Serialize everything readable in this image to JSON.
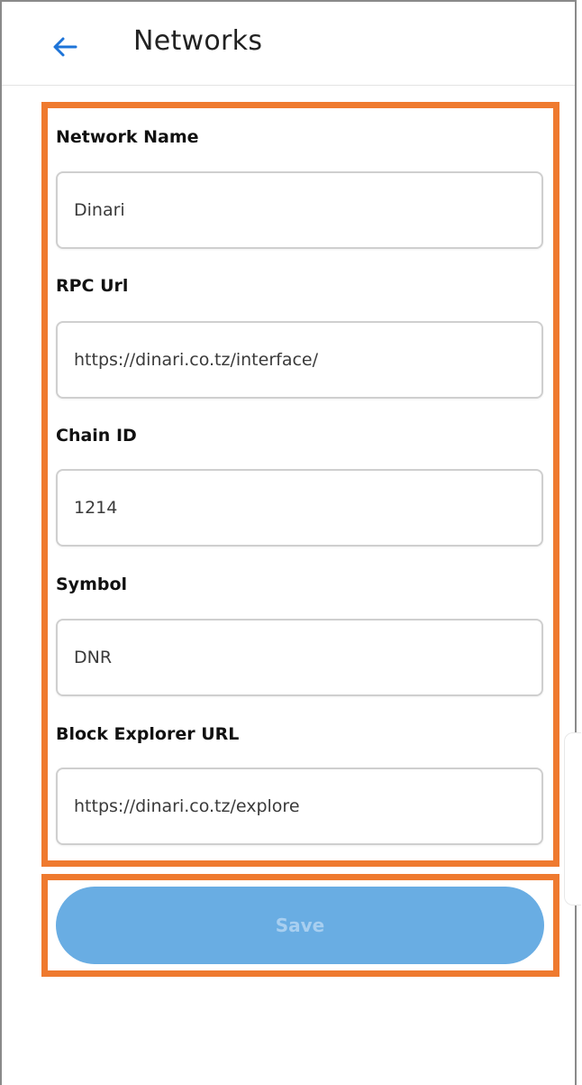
{
  "header": {
    "title": "Networks",
    "back_icon": "arrow-left-icon"
  },
  "form": {
    "fields": [
      {
        "label": "Network Name",
        "value": "Dinari"
      },
      {
        "label": "RPC Url",
        "value": "https://dinari.co.tz/interface/"
      },
      {
        "label": "Chain ID",
        "value": "1214"
      },
      {
        "label": "Symbol",
        "value": "DNR"
      },
      {
        "label": "Block Explorer URL",
        "value": "https://dinari.co.tz/explore"
      }
    ]
  },
  "actions": {
    "save_label": "Save"
  },
  "colors": {
    "accent_blue": "#1e74d8",
    "save_button_bg": "#69ade3",
    "highlight_border": "#ef7a2f"
  }
}
